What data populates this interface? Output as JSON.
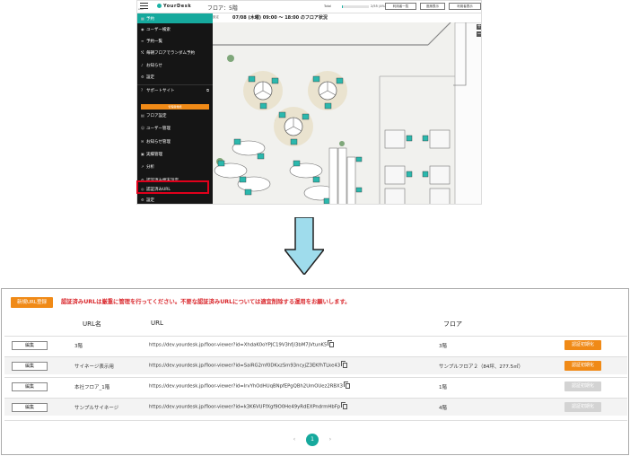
{
  "top_screen": {
    "hamburger_label": "Menu",
    "logo_text": "YourDesk",
    "floor_label": "フロア：5階",
    "usage_label": "Total",
    "usage_fraction": 0.04,
    "usage_count": "2/55 (4%)",
    "header_buttons": [
      "利用者一覧",
      "座席表示",
      "利用者表示"
    ],
    "subheader_prefix": "設定",
    "date_range": "07/08 (木曜) 09:00 〜 18:00 のフロア状況",
    "zoom_in": "+",
    "zoom_out": "−",
    "menu_items": [
      {
        "icon": "calendar-icon",
        "glyph": "▦",
        "label": "予約"
      },
      {
        "icon": "search-user-icon",
        "glyph": "◉",
        "label": "ユーザー検索"
      },
      {
        "icon": "list-icon",
        "glyph": "≡",
        "label": "予約一覧"
      },
      {
        "icon": "shuffle-icon",
        "glyph": "⤭",
        "label": "毎朝フロアでランダム予約"
      },
      {
        "icon": "bell-icon",
        "glyph": "♪",
        "label": "お知らせ"
      },
      {
        "icon": "gear-icon",
        "glyph": "⚙",
        "label": "設定"
      },
      {
        "icon": "support-icon",
        "glyph": "?",
        "label": "サポートサイト"
      }
    ],
    "admin_label": "管理者機能",
    "admin_items": [
      {
        "icon": "floor-icon",
        "glyph": "▤",
        "label": "フロア設定"
      },
      {
        "icon": "user-manage-icon",
        "glyph": "☺",
        "label": "ユーザー管理"
      },
      {
        "icon": "notice-manage-icon",
        "glyph": "✉",
        "label": "お知らせ管理"
      },
      {
        "icon": "record-icon",
        "glyph": "▣",
        "label": "実績管理"
      },
      {
        "icon": "analytics-icon",
        "glyph": "↗",
        "label": "分析"
      },
      {
        "icon": "auth-settings-icon",
        "glyph": "⚙",
        "label": "認証済み端末設定"
      },
      {
        "icon": "link-icon",
        "glyph": "◎",
        "label": "認証済みURL"
      },
      {
        "icon": "settings-icon",
        "glyph": "⚙",
        "label": "設定"
      }
    ]
  },
  "bottom_screen": {
    "new_url_button": "新規URL登録",
    "notice": "認証済みURLは厳重に管理を行ってください。不要な認証済みURLについては適宜削除する運用をお願いします。",
    "columns": {
      "name": "URL名",
      "url": "URL",
      "floor": "フロア"
    },
    "edit_label": "編集",
    "init_label": "認証初期化",
    "rows": [
      {
        "name": "3階",
        "url": "https://dev.yourdesk.jp/floor-viewer?id=XhdaK0oYPJC19V3hfjl3bM7jVtunK5",
        "floor": "3階",
        "init_enabled": true
      },
      {
        "name": "サイネージ表示用",
        "url": "https://dev.yourdesk.jp/floor-viewer?id=SaiRG2mf0DKxzSm93ncyjZ3EKfhTLke43",
        "floor": "サンプルフロア２（84坪、277.5㎡）",
        "init_enabled": true
      },
      {
        "name": "本社フロア_1階",
        "url": "https://dev.yourdesk.jp/floor-viewer?id=IrvYhOdHUqBNpfEPgQBh2UmOUez2RBX3",
        "floor": "1階",
        "init_enabled": false
      },
      {
        "name": "サンプルサイネージ",
        "url": "https://dev.yourdesk.jp/floor-viewer?id=k3K6VUFfXgf9O0He49yRdEXPndrmHbFp",
        "floor": "4階",
        "init_enabled": false
      }
    ],
    "pagination": {
      "prev": "‹",
      "current": "1",
      "next": "›"
    }
  },
  "colors": {
    "teal": "#16a99d",
    "orange": "#f08a17",
    "disabled": "#d3d3d3",
    "red": "#d9262b",
    "highlight": "#e0001b",
    "arrow_fill": "#9fdcec"
  }
}
